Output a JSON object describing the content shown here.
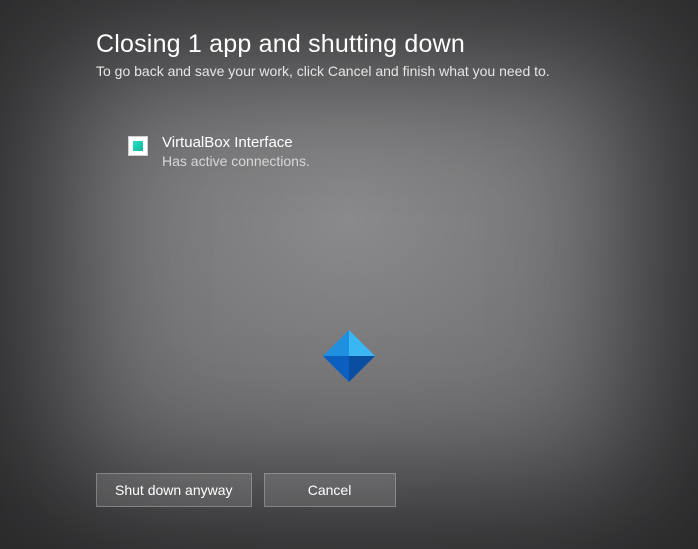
{
  "header": {
    "title": "Closing 1 app and shutting down",
    "subtitle": "To go back and save your work, click Cancel and finish what you need to."
  },
  "apps": [
    {
      "icon": "virtualbox-icon",
      "name": "VirtualBox Interface",
      "status": "Has active connections."
    }
  ],
  "buttons": {
    "shutdown_label": "Shut down anyway",
    "cancel_label": "Cancel"
  },
  "colors": {
    "logo_light": "#3ab6f2",
    "logo_dark": "#0b5fbf"
  }
}
